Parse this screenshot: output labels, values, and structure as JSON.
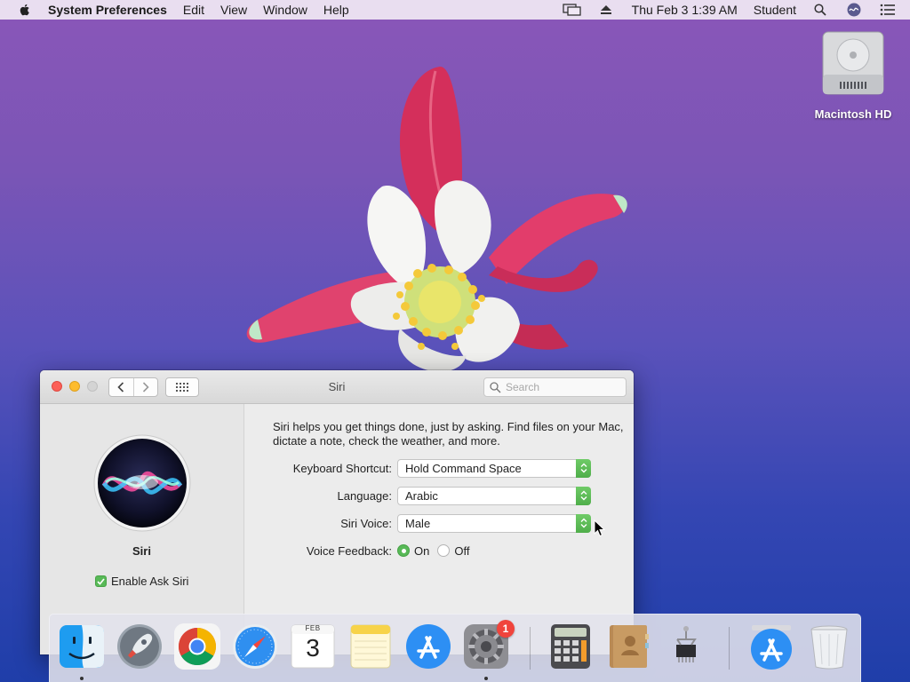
{
  "menubar": {
    "app_name": "System Preferences",
    "menus": [
      "Edit",
      "View",
      "Window",
      "Help"
    ],
    "clock": "Thu Feb 3  1:39 AM",
    "user": "Student",
    "icons": [
      "apple-icon",
      "display-mirroring-icon",
      "eject-icon",
      "spotlight-icon",
      "siri-icon",
      "notification-center-icon"
    ]
  },
  "desktop": {
    "drive_label": "Macintosh HD"
  },
  "window": {
    "title": "Siri",
    "search_placeholder": "Search",
    "sidebar": {
      "name": "Siri",
      "enable_label": "Enable Ask Siri",
      "enable_checked": true
    },
    "description": "Siri helps you get things done, just by asking. Find files on your Mac, dictate a note, check the weather, and more.",
    "keyboard_shortcut": {
      "label": "Keyboard Shortcut:",
      "value": "Hold Command Space"
    },
    "language": {
      "label": "Language:",
      "value": "Arabic"
    },
    "siri_voice": {
      "label": "Siri Voice:",
      "value": "Male"
    },
    "voice_feedback": {
      "label": "Voice Feedback:",
      "options": [
        "On",
        "Off"
      ],
      "selected": "On"
    }
  },
  "dock": {
    "apps": [
      "Finder",
      "Launchpad",
      "Google Chrome",
      "Safari",
      "Calendar",
      "Notes",
      "App Store",
      "System Preferences",
      "Calculator",
      "Contacts",
      "System Information",
      "App Store",
      "Trash"
    ],
    "calendar": {
      "month": "FEB",
      "day": "3"
    },
    "system_preferences_badge": "1"
  },
  "colors": {
    "accent_green": "#58b957",
    "close": "#fc5f57",
    "minimize": "#fdbc2e",
    "wallpaper_top": "#8a56b8",
    "wallpaper_bottom": "#1f3ea9"
  }
}
